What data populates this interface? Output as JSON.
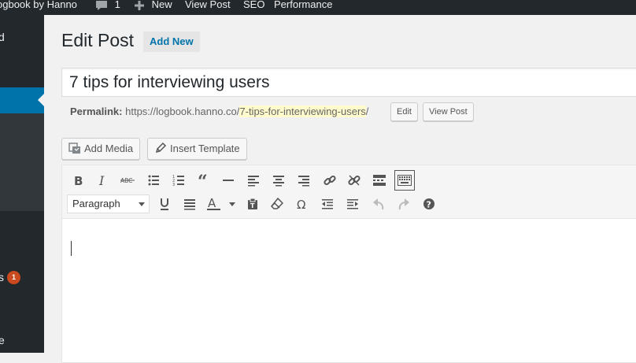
{
  "adminbar": {
    "site_name": "ogbook by Hanno",
    "comments_count": "1",
    "new_label": "New",
    "view_post_label": "View Post",
    "seo_label": "SEO",
    "performance_label": "Performance"
  },
  "sidebar": {
    "item_top": "d",
    "item_plugins": "s",
    "plugins_badge": "1",
    "item_bottom": "e"
  },
  "page": {
    "title": "Edit Post",
    "add_new": "Add New"
  },
  "post": {
    "title": "7 tips for interviewing users"
  },
  "permalink": {
    "label": "Permalink:",
    "base": "https://logbook.hanno.co/",
    "slug": "7-tips-for-interviewing-users",
    "trailing": "/",
    "edit_label": "Edit",
    "view_label": "View Post"
  },
  "media": {
    "add_media": "Add Media",
    "insert_template": "Insert Template"
  },
  "editor": {
    "format_value": "Paragraph",
    "colors": {
      "accent": "#0073aa",
      "slug_highlight": "#fffbcc",
      "badge": "#ca4a1f"
    },
    "row1_icons": [
      "bold-icon",
      "italic-icon",
      "strikethrough-icon",
      "bullet-list-icon",
      "numbered-list-icon",
      "blockquote-icon",
      "horizontal-line-icon",
      "align-left-icon",
      "align-center-icon",
      "align-right-icon",
      "insert-link-icon",
      "remove-link-icon",
      "read-more-icon",
      "toolbar-toggle-icon"
    ],
    "row2_icons": [
      "underline-icon",
      "justify-icon",
      "text-color-icon",
      "paste-as-text-icon",
      "clear-formatting-icon",
      "special-character-icon",
      "outdent-icon",
      "indent-icon",
      "undo-icon",
      "redo-icon",
      "help-icon"
    ]
  }
}
